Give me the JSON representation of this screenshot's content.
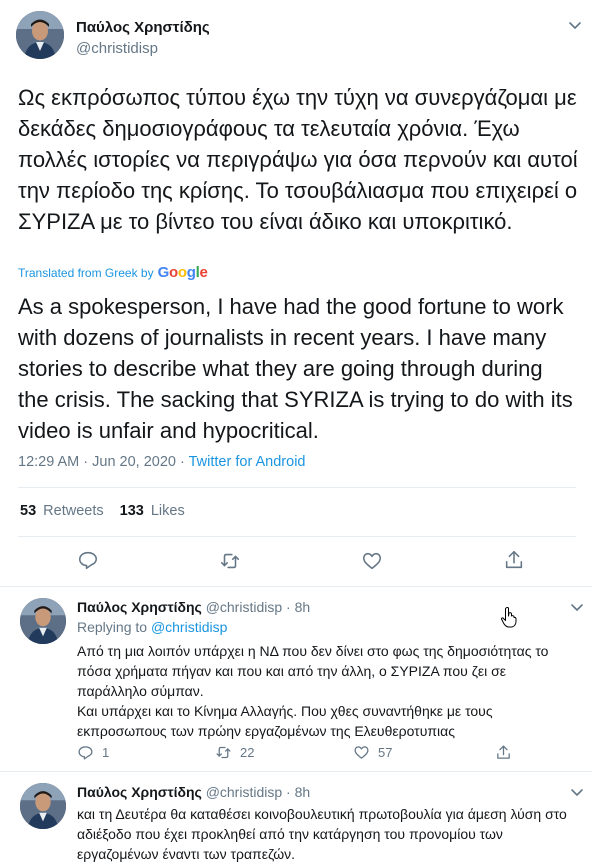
{
  "main": {
    "name": "Παύλος Χρηστίδης",
    "handle": "@christidisp",
    "greek_text": "Ως εκπρόσωπος τύπου έχω την τύχη να συνεργάζομαι με δεκάδες δημοσιογράφους τα τελευταία χρόνια. Έχω πολλές ιστορίες να περιγράψω για όσα περνούν και αυτοί την περίοδο της κρίσης. Το τσουβάλιασμα που επιχειρεί ο ΣΥΡΙΖΑ με το βίντεο του είναι άδικο και υποκριτικό.",
    "translated_label": "Translated from Greek by",
    "google_label": "Google",
    "english_text": "As a spokesperson, I have had the good fortune to work with dozens of journalists in recent years. I have many stories to describe what they are going through during the crisis. The sacking that SYRIZA is trying to do with its video is unfair and hypocritical.",
    "time": "12:29 AM · Jun 20, 2020 · ",
    "source": "Twitter for Android",
    "retweets_count": "53",
    "retweets_label": "Retweets",
    "likes_count": "133",
    "likes_label": "Likes"
  },
  "replies": [
    {
      "name": "Παύλος Χρηστίδης",
      "handle": "@christidisp · 8h",
      "replying_label": "Replying to",
      "replying_to": "@christidisp",
      "text": "Από τη μια λοιπόν υπάρχει η ΝΔ που δεν δίνει στο φως της δημοσιότητας το πόσα χρήματα πήγαν και που και από την άλλη, ο ΣΥΡΙΖΑ που ζει σε παράλληλο σύμπαν.",
      "text2": "Και υπάρχει και το Κίνημα Αλλαγής. Που χθες συναντήθηκε με τους εκπροσωπους των πρώην εργαζομένων της Ελευθεροτυπιας",
      "reply_count": "1",
      "retweet_count": "22",
      "like_count": "57"
    },
    {
      "name": "Παύλος Χρηστίδης",
      "handle": "@christidisp · 8h",
      "text": "και τη Δευτέρα θα καταθέσει κοινοβουλευτική πρωτοβουλία για άμεση λύση στο αδιέξοδο που έχει προκληθεί από την κατάργηση του προνομίου των εργαζομένων έναντι των τραπεζών."
    }
  ],
  "colors": {
    "accent": "#1b95e0",
    "muted": "#657786",
    "text": "#14171a",
    "border": "#e6ecf0"
  },
  "icons": [
    "chevron-down-icon",
    "reply-icon",
    "retweet-icon",
    "like-icon",
    "share-icon",
    "hand-cursor-icon"
  ]
}
